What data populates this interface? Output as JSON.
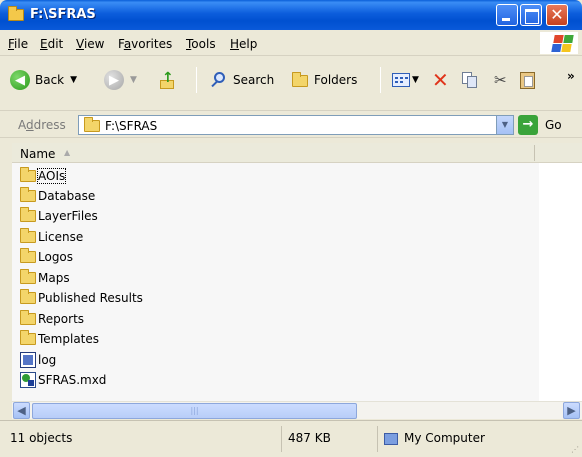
{
  "window": {
    "title": "F:\\SFRAS"
  },
  "menu": [
    {
      "label": "File",
      "accel": "F"
    },
    {
      "label": "Edit",
      "accel": "E"
    },
    {
      "label": "View",
      "accel": "V"
    },
    {
      "label": "Favorites",
      "accel": "a"
    },
    {
      "label": "Tools",
      "accel": "T"
    },
    {
      "label": "Help",
      "accel": "H"
    }
  ],
  "toolbar": {
    "back_label": "Back",
    "search_label": "Search",
    "folders_label": "Folders",
    "overflow_glyph": "»"
  },
  "address": {
    "label": "Address",
    "value": "F:\\SFRAS",
    "go_label": "Go"
  },
  "list": {
    "column_name": "Name",
    "items": [
      {
        "name": "AOIs",
        "icon": "folder-icon"
      },
      {
        "name": "Database",
        "icon": "folder-icon"
      },
      {
        "name": "LayerFiles",
        "icon": "folder-icon"
      },
      {
        "name": "License",
        "icon": "folder-icon"
      },
      {
        "name": "Logos",
        "icon": "folder-icon"
      },
      {
        "name": "Maps",
        "icon": "folder-icon"
      },
      {
        "name": "Published Results",
        "icon": "folder-icon"
      },
      {
        "name": "Reports",
        "icon": "folder-icon"
      },
      {
        "name": "Templates",
        "icon": "folder-icon"
      },
      {
        "name": "log",
        "icon": "log-file-icon"
      },
      {
        "name": "SFRAS.mxd",
        "icon": "mxd-file-icon"
      }
    ]
  },
  "status": {
    "objects": "11 objects",
    "size": "487 KB",
    "zone": "My Computer"
  },
  "colors": {
    "titlebar": "#0a5fd8",
    "close_button": "#c6411f",
    "delete_x": "#e0341a",
    "go_green": "#3aa43a"
  }
}
